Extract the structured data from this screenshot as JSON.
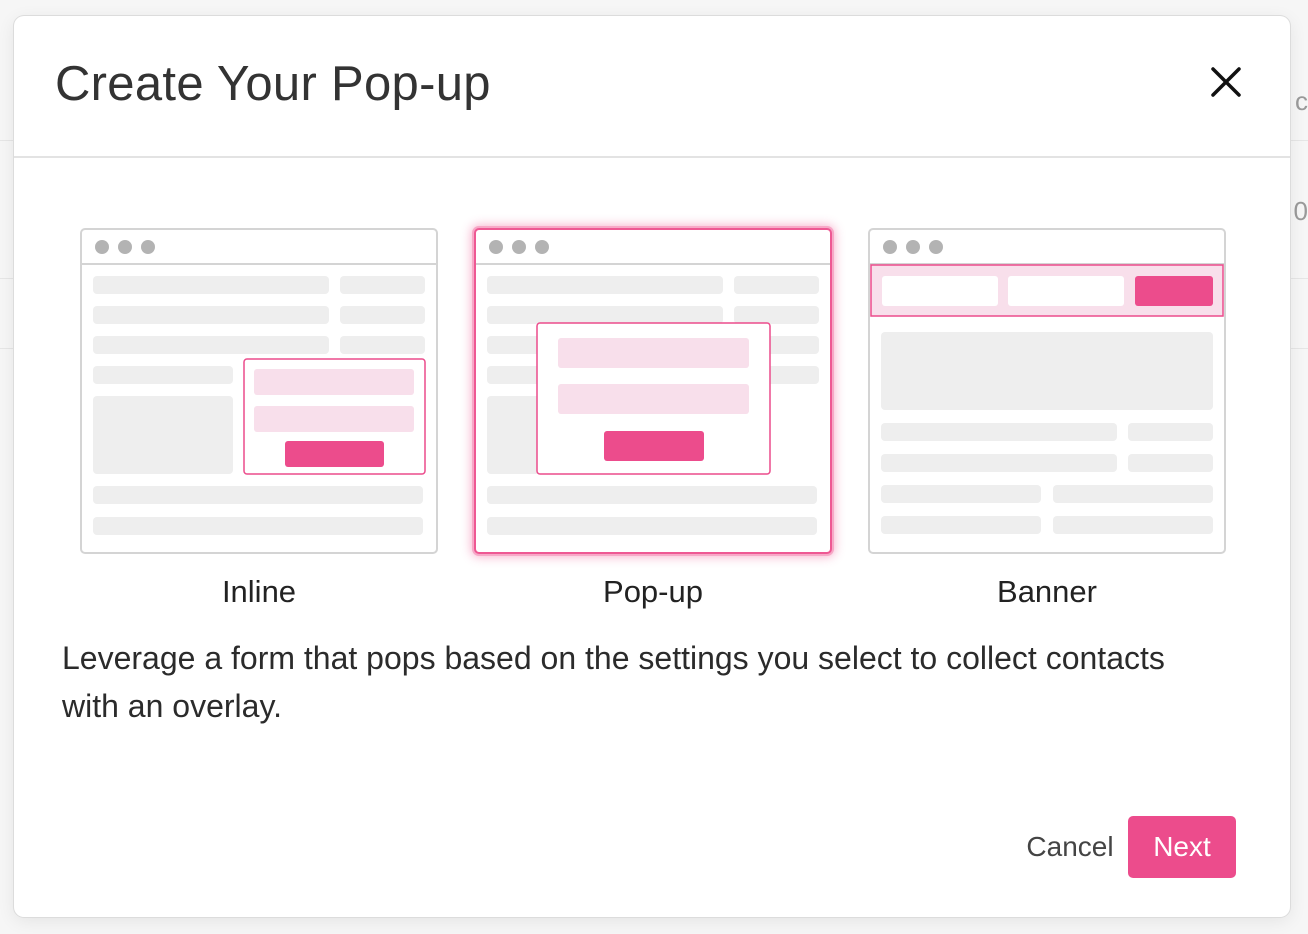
{
  "dialog": {
    "title": "Create Your Pop-up",
    "close_icon": "close-icon"
  },
  "options": [
    {
      "id": "inline",
      "label": "Inline",
      "selected": false
    },
    {
      "id": "popup",
      "label": "Pop-up",
      "selected": true
    },
    {
      "id": "banner",
      "label": "Banner",
      "selected": false
    }
  ],
  "description": "Leverage a form that pops based on the settings you select to collect contacts with an overlay.",
  "footer": {
    "cancel_label": "Cancel",
    "next_label": "Next"
  },
  "colors": {
    "accent": "#ec4c8c",
    "accent_light": "#f8dfeb",
    "placeholder_gray": "#eeeeee",
    "window_dot": "#b3b3b3"
  }
}
